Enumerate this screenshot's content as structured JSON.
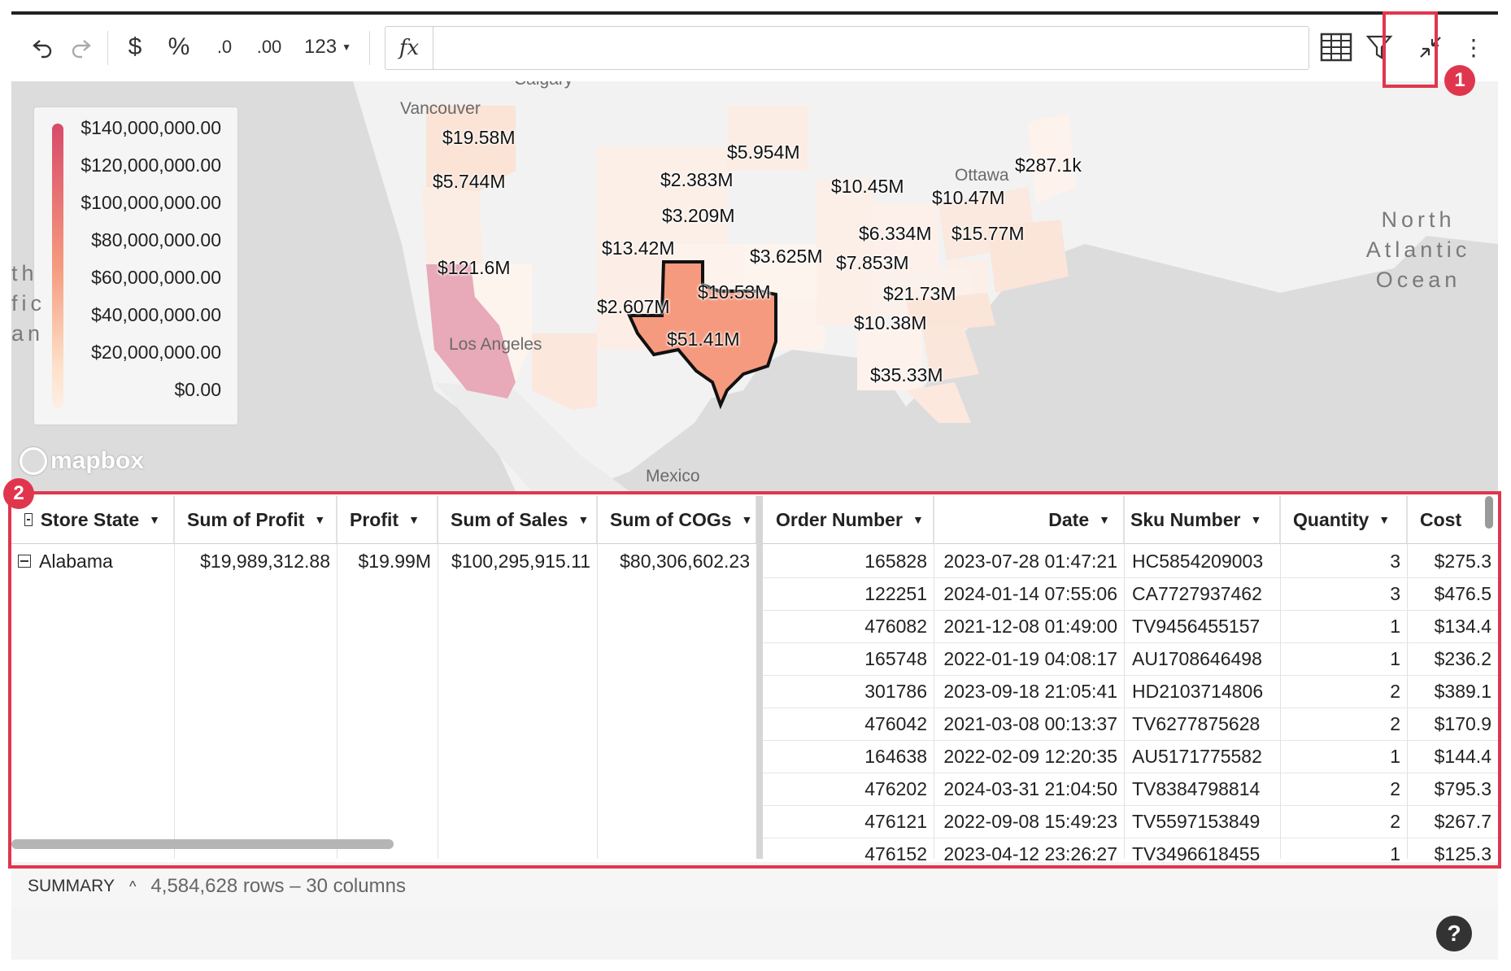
{
  "toolbar": {
    "undo_icon": "undo-icon",
    "redo_icon": "redo-icon",
    "currency_label": "$",
    "percent_label": "%",
    "decrease_decimals_label": ".0",
    "increase_decimals_label": ".00",
    "number_format_label": "123",
    "fx_label": "fx",
    "formula_value": ""
  },
  "map": {
    "legend": [
      "$140,000,000.00",
      "$120,000,000.00",
      "$100,000,000.00",
      "$80,000,000.00",
      "$60,000,000.00",
      "$40,000,000.00",
      "$20,000,000.00",
      "$0.00"
    ],
    "labels": {
      "wa": "$19.58M",
      "or": "$5.744M",
      "ca": "$121.6M",
      "mt": "$5.954M",
      "wy": "$2.383M",
      "co": "$3.209M",
      "nm": "$13.42M",
      "az": "$2.607M",
      "ok": "$10.53M",
      "tx": "$51.41M",
      "ks": "$3.625M",
      "mi": "$10.45M",
      "pa": "$10.47M",
      "me": "$287.1k",
      "oh": "$6.334M",
      "va": "$15.77M",
      "ky": "$7.853M",
      "nc": "$21.73M",
      "ga": "$10.38M",
      "fl": "$35.33M"
    },
    "places": {
      "vancouver": "Vancouver",
      "calgary": "Calgary",
      "ottawa": "Ottawa",
      "los_angeles": "Los Angeles",
      "mexico": "Mexico"
    },
    "ocean_lines": [
      "North",
      "Atlantic",
      "Ocean"
    ],
    "pacific_fragment": [
      "th",
      "fic",
      "an"
    ],
    "attribution": "mapbox"
  },
  "table": {
    "left_headers": [
      "Store State",
      "Sum of Profit",
      "Profit",
      "Sum of Sales",
      "Sum of COGs"
    ],
    "group": {
      "state": "Alabama",
      "sum_profit": "$19,989,312.88",
      "profit": "$19.99M",
      "sum_sales": "$100,295,915.11",
      "sum_cogs": "$80,306,602.23"
    },
    "right_headers": [
      "Order Number",
      "Date",
      "Sku Number",
      "Quantity",
      "Cost"
    ],
    "rows": [
      [
        "165828",
        "2023-07-28 01:47:21",
        "HC5854209003",
        "3",
        "$275.3"
      ],
      [
        "122251",
        "2024-01-14 07:55:06",
        "CA7727937462",
        "3",
        "$476.5"
      ],
      [
        "476082",
        "2021-12-08 01:49:00",
        "TV9456455157",
        "1",
        "$134.4"
      ],
      [
        "165748",
        "2022-01-19 04:08:17",
        "AU1708646498",
        "1",
        "$236.2"
      ],
      [
        "301786",
        "2023-09-18 21:05:41",
        "HD2103714806",
        "2",
        "$389.1"
      ],
      [
        "476042",
        "2021-03-08 00:13:37",
        "TV6277875628",
        "2",
        "$170.9"
      ],
      [
        "164638",
        "2022-02-09 12:20:35",
        "AU5171775582",
        "1",
        "$144.4"
      ],
      [
        "476202",
        "2024-03-31 21:04:50",
        "TV8384798814",
        "2",
        "$795.3"
      ],
      [
        "476121",
        "2022-09-08 15:49:23",
        "TV5597153849",
        "2",
        "$267.7"
      ],
      [
        "476152",
        "2023-04-12 23:26:27",
        "TV3496618455",
        "1",
        "$125.3"
      ]
    ]
  },
  "summary": {
    "label": "SUMMARY",
    "counts": "4,584,628 rows – 30 columns"
  },
  "badges": [
    "1",
    "2"
  ],
  "help_label": "?",
  "colors": {
    "highlight": "#e0364d",
    "texas": "#f59a7e",
    "california": "#e8a9b8"
  }
}
